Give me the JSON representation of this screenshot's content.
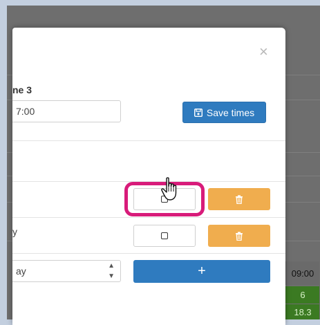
{
  "modal": {
    "close_label": "×",
    "day_label": "ne 3",
    "time_value": "7:00",
    "save_button_label": "Save times",
    "row_label": "y",
    "select_value": "ay",
    "add_button_label": "+"
  },
  "background": {
    "time_cell": "09:00",
    "green_values": [
      "6",
      "18.3"
    ]
  },
  "colors": {
    "primary": "#2f7bbf",
    "warning": "#f0ad4e",
    "highlight": "#d81b7a",
    "success_bg": "#3b7a22"
  },
  "icons": [
    "close-icon",
    "floppy-disk-icon",
    "checkbox-icon",
    "trash-icon",
    "plus-icon",
    "hand-pointer-icon"
  ]
}
